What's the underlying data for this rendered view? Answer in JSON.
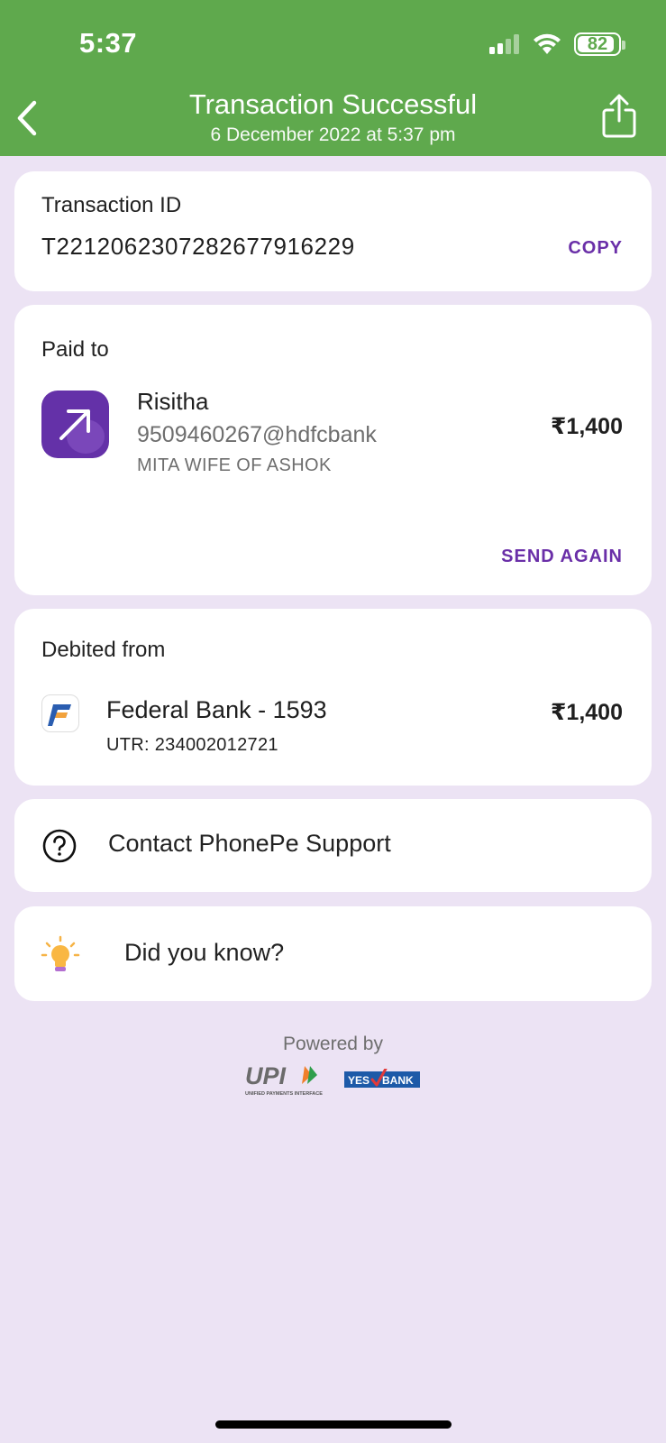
{
  "status_bar": {
    "time": "5:37",
    "battery": "82"
  },
  "header": {
    "title": "Transaction Successful",
    "subtitle": "6 December 2022 at 5:37 pm",
    "background_color": "#5fa94d"
  },
  "transaction": {
    "label": "Transaction ID",
    "id": "T2212062307282677916229",
    "copy_label": "COPY"
  },
  "paid_to": {
    "label": "Paid to",
    "name": "Risitha",
    "upi_id": "9509460267@hdfcbank",
    "account_name": "MITA WIFE OF ASHOK",
    "amount": "₹1,400",
    "send_again_label": "SEND AGAIN",
    "avatar_icon": "arrow-up-right-icon"
  },
  "debited_from": {
    "label": "Debited from",
    "bank": "Federal Bank - 1593",
    "utr": "UTR: 234002012721",
    "amount": "₹1,400",
    "bank_icon": "federal-bank-logo"
  },
  "support": {
    "label": "Contact PhonePe Support",
    "icon": "question-circle-icon"
  },
  "tip": {
    "label": "Did you know?",
    "icon": "lightbulb-icon"
  },
  "footer": {
    "powered_by": "Powered by",
    "upi_logo_text": "UPI",
    "upi_tagline": "UNIFIED PAYMENTS INTERFACE",
    "yes_bank_text_1": "YES",
    "yes_bank_text_2": "BANK"
  },
  "accent_color": "#6a2fa8"
}
